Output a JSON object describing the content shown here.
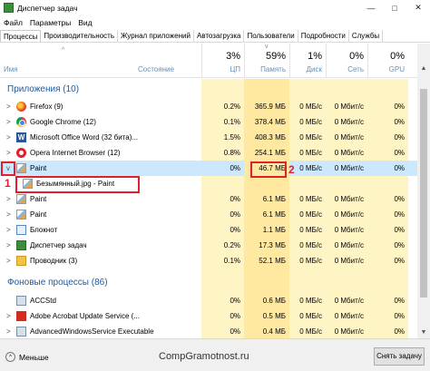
{
  "window": {
    "title": "Диспетчер задач",
    "controls": [
      "—",
      "□",
      "✕"
    ]
  },
  "menu": [
    "Файл",
    "Параметры",
    "Вид"
  ],
  "tabs": [
    "Процессы",
    "Производительность",
    "Журнал приложений",
    "Автозагрузка",
    "Пользователи",
    "Подробности",
    "Службы"
  ],
  "columns": {
    "name": "Имя",
    "status": "Состояние",
    "cpu": {
      "pct": "3%",
      "label": "ЦП"
    },
    "memory": {
      "pct": "59%",
      "label": "Память"
    },
    "disk": {
      "pct": "1%",
      "label": "Диск"
    },
    "network": {
      "pct": "0%",
      "label": "Сеть"
    },
    "gpu": {
      "pct": "0%",
      "label": "GPU"
    }
  },
  "groups": {
    "apps": "Приложения (10)",
    "background": "Фоновые процессы (86)"
  },
  "rows": [
    {
      "name": "Firefox (9)",
      "icon": "firefox-icon",
      "cpu": "0.2%",
      "mem": "365.9 МБ",
      "disk": "0 МБ/с",
      "net": "0 Мбит/с",
      "gpu": "0%"
    },
    {
      "name": "Google Chrome (12)",
      "icon": "chrome-icon",
      "cpu": "0.1%",
      "mem": "378.4 МБ",
      "disk": "0 МБ/с",
      "net": "0 Мбит/с",
      "gpu": "0%"
    },
    {
      "name": "Microsoft Office Word (32 бита)...",
      "icon": "word-icon",
      "cpu": "1.5%",
      "mem": "408.3 МБ",
      "disk": "0 МБ/с",
      "net": "0 Мбит/с",
      "gpu": "0%"
    },
    {
      "name": "Opera Internet Browser (12)",
      "icon": "opera-icon",
      "cpu": "0.8%",
      "mem": "254.1 МБ",
      "disk": "0 МБ/с",
      "net": "0 Мбит/с",
      "gpu": "0%"
    },
    {
      "name": "Paint",
      "icon": "paint-icon",
      "cpu": "0%",
      "mem": "46.7 МБ",
      "disk": "0 МБ/с",
      "net": "0 Мбит/с",
      "gpu": "0%"
    },
    {
      "name": "Безымянный.jpg - Paint",
      "icon": "paint-icon",
      "cpu": "",
      "mem": "",
      "disk": "",
      "net": "",
      "gpu": ""
    },
    {
      "name": "Paint",
      "icon": "paint-icon",
      "cpu": "0%",
      "mem": "6.1 МБ",
      "disk": "0 МБ/с",
      "net": "0 Мбит/с",
      "gpu": "0%"
    },
    {
      "name": "Paint",
      "icon": "paint-icon",
      "cpu": "0%",
      "mem": "6.1 МБ",
      "disk": "0 МБ/с",
      "net": "0 Мбит/с",
      "gpu": "0%"
    },
    {
      "name": "Блокнот",
      "icon": "notepad-icon",
      "cpu": "0%",
      "mem": "1.1 МБ",
      "disk": "0 МБ/с",
      "net": "0 Мбит/с",
      "gpu": "0%"
    },
    {
      "name": "Диспетчер задач",
      "icon": "task-manager-icon",
      "cpu": "0.2%",
      "mem": "17.3 МБ",
      "disk": "0 МБ/с",
      "net": "0 Мбит/с",
      "gpu": "0%"
    },
    {
      "name": "Проводник (3)",
      "icon": "explorer-icon",
      "cpu": "0.1%",
      "mem": "52.1 МБ",
      "disk": "0 МБ/с",
      "net": "0 Мбит/с",
      "gpu": "0%"
    },
    {
      "name": "ACCStd",
      "icon": "generic-process-icon",
      "cpu": "0%",
      "mem": "0.6 МБ",
      "disk": "0 МБ/с",
      "net": "0 Мбит/с",
      "gpu": "0%"
    },
    {
      "name": "Adobe Acrobat Update Service (...",
      "icon": "acrobat-icon",
      "cpu": "0%",
      "mem": "0.5 МБ",
      "disk": "0 МБ/с",
      "net": "0 Мбит/с",
      "gpu": "0%"
    },
    {
      "name": "AdvancedWindowsService Executable",
      "icon": "generic-process-icon",
      "cpu": "0%",
      "mem": "0.4 МБ",
      "disk": "0 МБ/с",
      "net": "0 Мбит/с",
      "gpu": "0%"
    }
  ],
  "annotations": [
    "1",
    "2",
    "3"
  ],
  "footer": {
    "less": "Меньше",
    "watermark": "CompGramotnost.ru",
    "end_task": "Снять задачу"
  }
}
